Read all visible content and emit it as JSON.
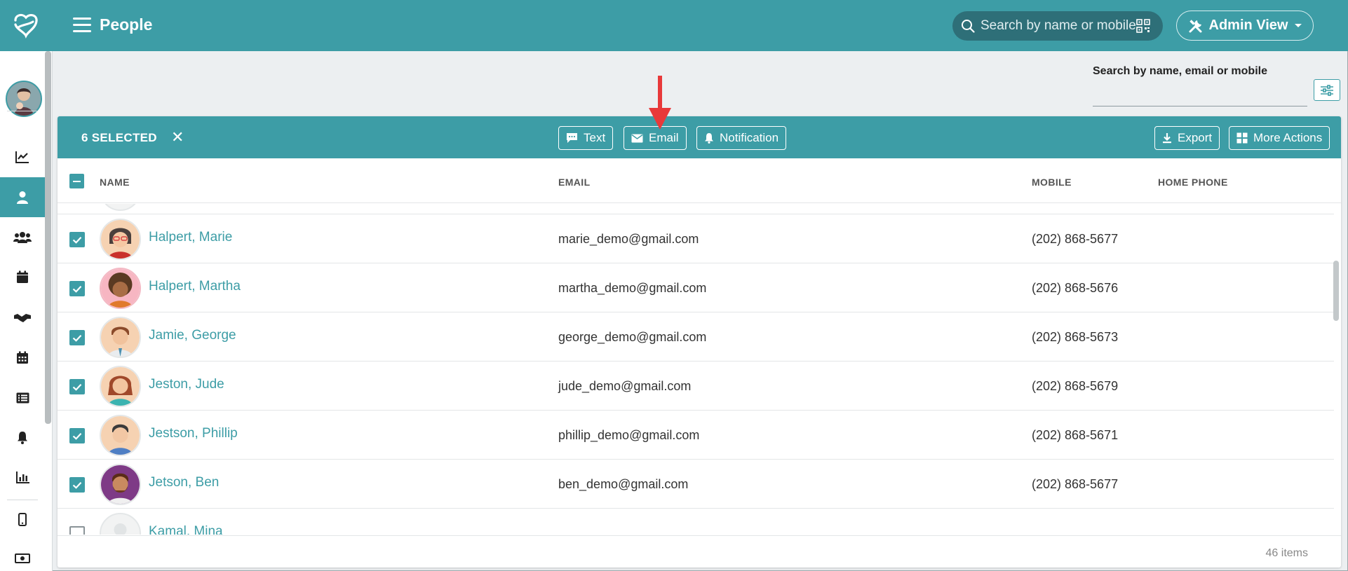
{
  "header": {
    "title": "People",
    "search_placeholder": "Search by name or mobile",
    "admin_label": "Admin View"
  },
  "sidebar": {
    "items": [
      {
        "icon": "chart-line-icon",
        "active": false
      },
      {
        "icon": "person-icon",
        "active": true
      },
      {
        "icon": "group-icon",
        "active": false
      },
      {
        "icon": "calendar-icon",
        "active": false
      },
      {
        "icon": "handshake-icon",
        "active": false
      },
      {
        "icon": "calendar-grid-icon",
        "active": false
      },
      {
        "icon": "list-icon",
        "active": false
      },
      {
        "icon": "bell-icon",
        "active": false
      },
      {
        "icon": "bar-chart-icon",
        "active": false
      },
      {
        "icon": "mobile-icon",
        "active": false
      },
      {
        "icon": "money-icon",
        "active": false
      }
    ]
  },
  "filter": {
    "label": "Search by name, email or mobile",
    "value": ""
  },
  "selection": {
    "count_label": "6 SELECTED",
    "clear": "✕",
    "text_label": "Text",
    "email_label": "Email",
    "notification_label": "Notification",
    "export_label": "Export",
    "more_label": "More Actions"
  },
  "table": {
    "columns": {
      "name": "NAME",
      "email": "EMAIL",
      "mobile": "MOBILE",
      "home_phone": "HOME PHONE"
    },
    "rows": [
      {
        "name": "Halpert, Marie",
        "email": "marie_demo@gmail.com",
        "mobile": "(202) 868-5677",
        "checked": true
      },
      {
        "name": "Halpert, Martha",
        "email": "martha_demo@gmail.com",
        "mobile": "(202) 868-5676",
        "checked": true
      },
      {
        "name": "Jamie, George",
        "email": "george_demo@gmail.com",
        "mobile": "(202) 868-5673",
        "checked": true
      },
      {
        "name": "Jeston, Jude",
        "email": "jude_demo@gmail.com",
        "mobile": "(202) 868-5679",
        "checked": true
      },
      {
        "name": "Jestson, Phillip",
        "email": "phillip_demo@gmail.com",
        "mobile": "(202) 868-5671",
        "checked": true
      },
      {
        "name": "Jetson, Ben",
        "email": "ben_demo@gmail.com",
        "mobile": "(202) 868-5677",
        "checked": true
      },
      {
        "name": "Kamal, Mina",
        "email": "",
        "mobile": "",
        "checked": false
      }
    ],
    "item_count": "46 items"
  },
  "colors": {
    "brand": "#3d9da6",
    "annotation_arrow": "#e8393a"
  }
}
